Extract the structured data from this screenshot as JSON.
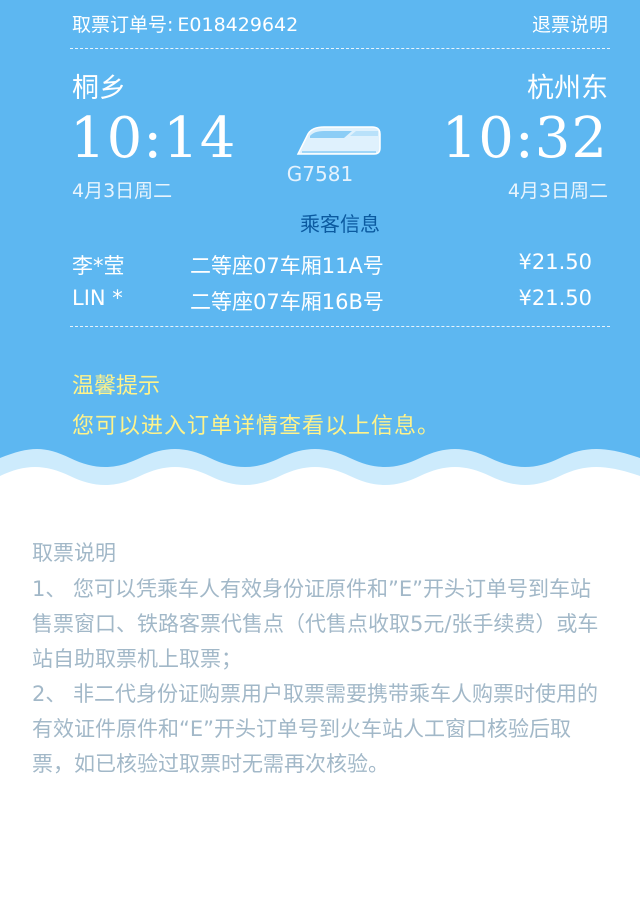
{
  "header": {
    "order_label": "取票订单号:",
    "order_number": "E018429642",
    "refund_link": "退票说明"
  },
  "trip": {
    "from_station": "桐乡",
    "to_station": "杭州东",
    "depart_time": "10:14",
    "arrive_time": "10:32",
    "depart_date": "4月3日周二",
    "arrive_date": "4月3日周二",
    "train_number": "G7581"
  },
  "passengers": {
    "title": "乘客信息",
    "rows": [
      {
        "name": "李*莹",
        "seat": "二等座07车厢11A号",
        "price": "¥21.50"
      },
      {
        "name": "LIN *",
        "seat": "二等座07车厢16B号",
        "price": "¥21.50"
      }
    ]
  },
  "tip": {
    "title": "温馨提示",
    "text": "您可以进入订单详情查看以上信息。"
  },
  "notes": {
    "title": "取票说明",
    "items": [
      "1、 您可以凭乘车人有效身份证原件和”E”开头订单号到车站售票窗口、铁路客票代售点（代售点收取5元/张手续费）或车站自助取票机上取票；",
      "2、 非二代身份证购票用户取票需要携带乘车人购票时使用的有效证件原件和“E”开头订单号到火车站人工窗口核验后取票，如已核验过取票时无需再次核验。"
    ]
  },
  "colors": {
    "ticket_bg": "#5db7f1",
    "tip_text": "#fff38a",
    "passenger_title": "#0b5aa0",
    "notes_text": "#a2b8c8"
  },
  "icons": {
    "train": "train-icon"
  }
}
